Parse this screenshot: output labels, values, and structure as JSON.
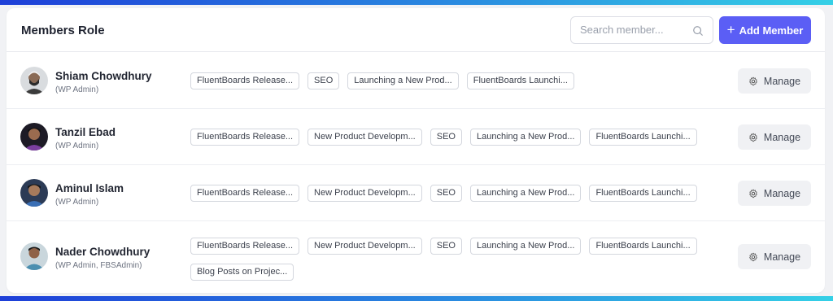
{
  "header": {
    "title": "Members Role",
    "search_placeholder": "Search member...",
    "add_button_label": "Add Member",
    "accent_color": "#5b5ef5"
  },
  "members": [
    {
      "name": "Shiam Chowdhury",
      "role": "(WP Admin)",
      "tags": [
        "FluentBoards Release...",
        "SEO",
        "Launching a New Prod...",
        "FluentBoards Launchi..."
      ],
      "manage_label": "Manage"
    },
    {
      "name": "Tanzil Ebad",
      "role": "(WP Admin)",
      "tags": [
        "FluentBoards Release...",
        "New Product Developm...",
        "SEO",
        "Launching a New Prod...",
        "FluentBoards Launchi..."
      ],
      "manage_label": "Manage"
    },
    {
      "name": "Aminul Islam",
      "role": "(WP Admin)",
      "tags": [
        "FluentBoards Release...",
        "New Product Developm...",
        "SEO",
        "Launching a New Prod...",
        "FluentBoards Launchi..."
      ],
      "manage_label": "Manage"
    },
    {
      "name": "Nader Chowdhury",
      "role": "(WP Admin, FBSAdmin)",
      "tags": [
        "FluentBoards Release...",
        "New Product Developm...",
        "SEO",
        "Launching a New Prod...",
        "FluentBoards Launchi...",
        "Blog Posts on Projec..."
      ],
      "manage_label": "Manage"
    }
  ],
  "icons": {
    "search": "search-icon",
    "plus": "plus-icon",
    "manage": "gear-icon"
  }
}
